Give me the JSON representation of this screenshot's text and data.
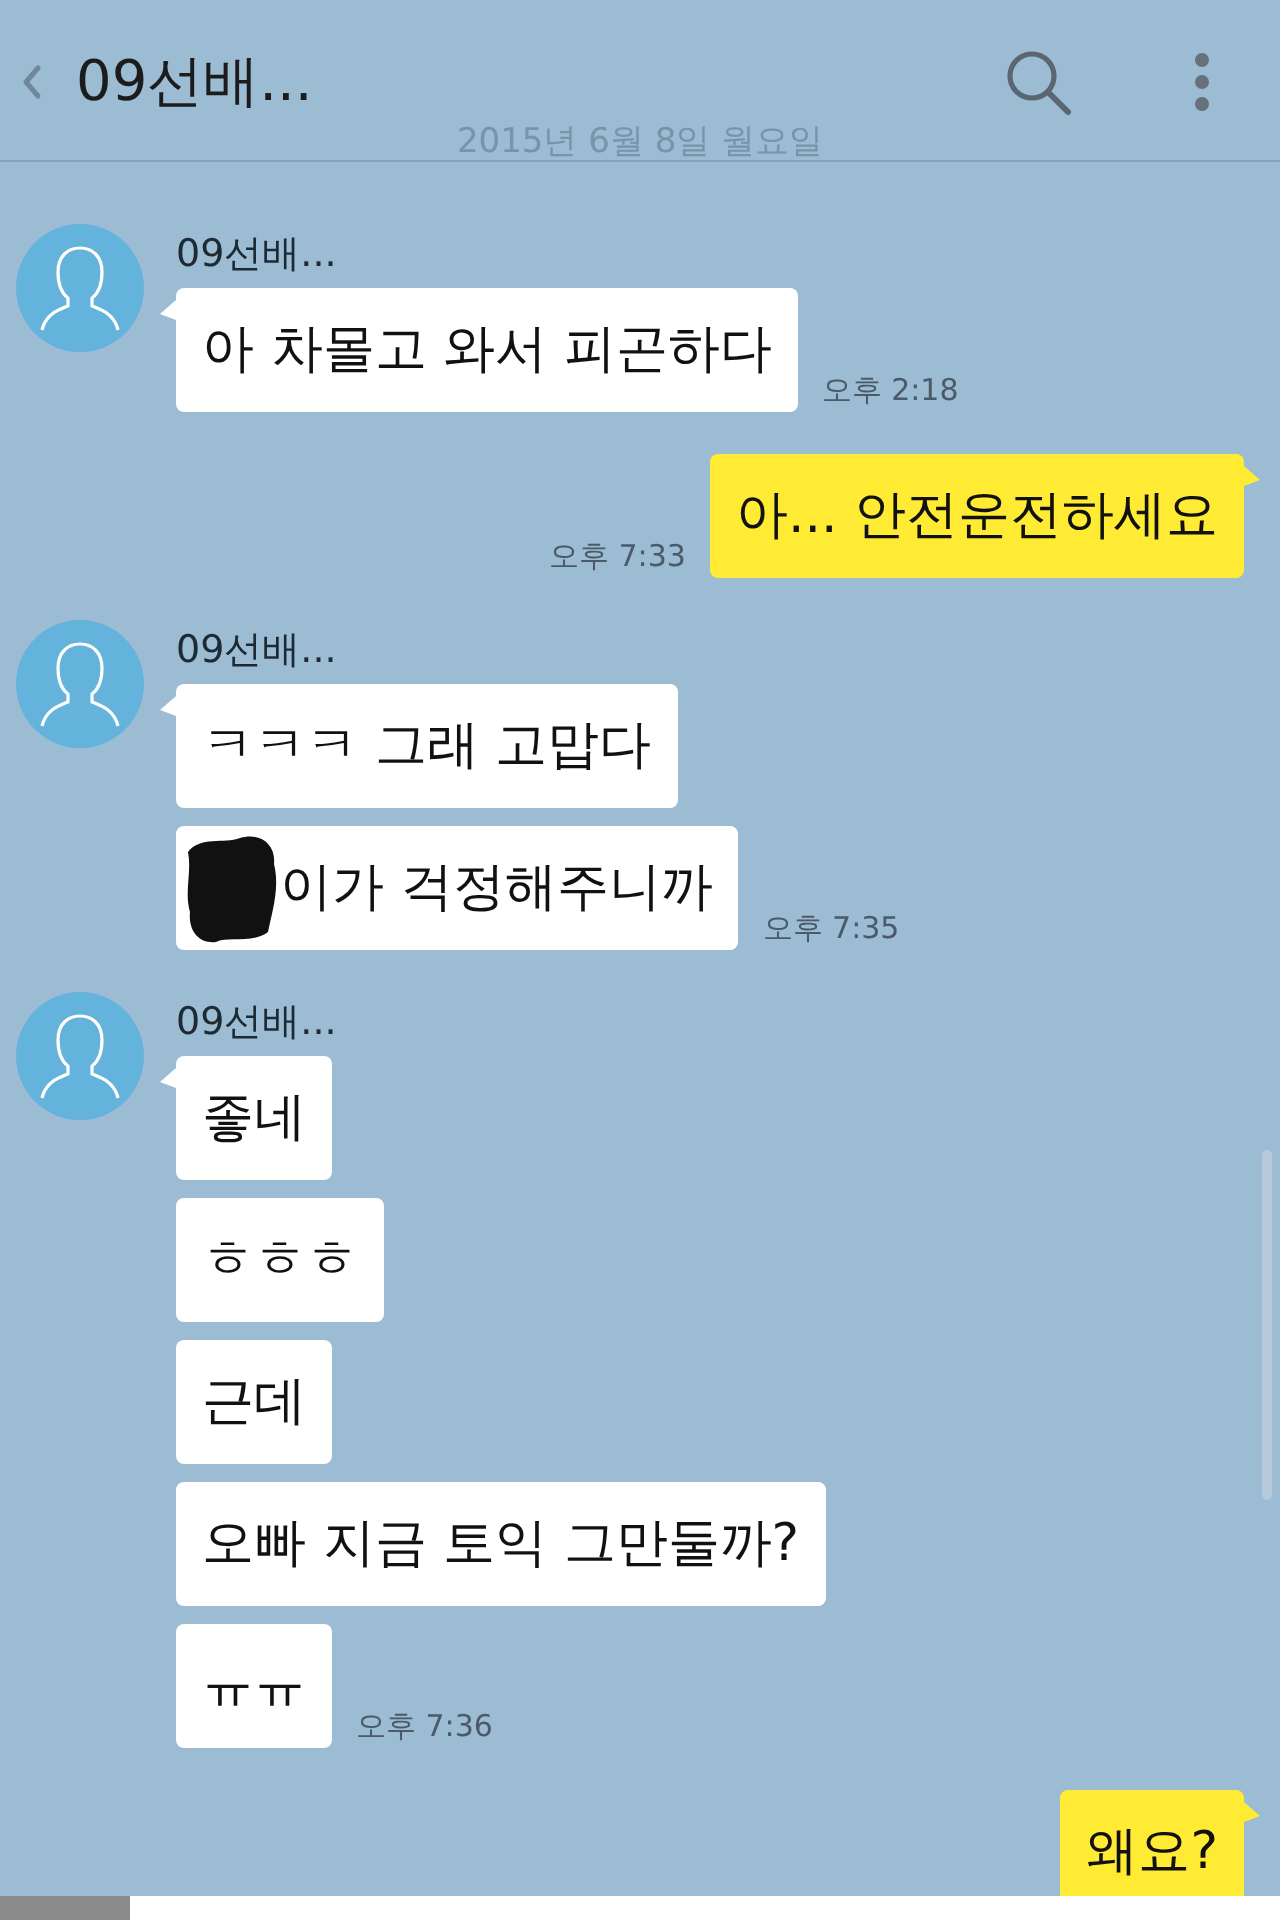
{
  "header": {
    "title": "09선배...",
    "date": "2015년 6월 8일 월요일"
  },
  "messages": [
    {
      "kind": "received",
      "sender": "09선배...",
      "bubbles": [
        {
          "text": "아 차몰고 와서 피곤하다",
          "redacted": false
        }
      ],
      "time": "오후 2:18"
    },
    {
      "kind": "sent",
      "bubbles": [
        {
          "text": "아... 안전운전하세요",
          "redacted": false
        }
      ],
      "time": "오후 7:33"
    },
    {
      "kind": "received",
      "sender": "09선배...",
      "bubbles": [
        {
          "text": "ㅋㅋㅋ 그래 고맙다",
          "redacted": false
        },
        {
          "text": "이가 걱정해주니까",
          "redacted": true
        }
      ],
      "time": "오후 7:35"
    },
    {
      "kind": "received",
      "sender": "09선배...",
      "bubbles": [
        {
          "text": "좋네",
          "redacted": false
        },
        {
          "text": "ㅎㅎㅎ",
          "redacted": false
        },
        {
          "text": "근데",
          "redacted": false
        },
        {
          "text": "오빠 지금 토익 그만둘까?",
          "redacted": false
        },
        {
          "text": "ㅠㅠ",
          "redacted": false
        }
      ],
      "time": "오후 7:36"
    },
    {
      "kind": "sent",
      "bubbles": [
        {
          "text": "왜요?",
          "redacted": false
        }
      ]
    }
  ]
}
